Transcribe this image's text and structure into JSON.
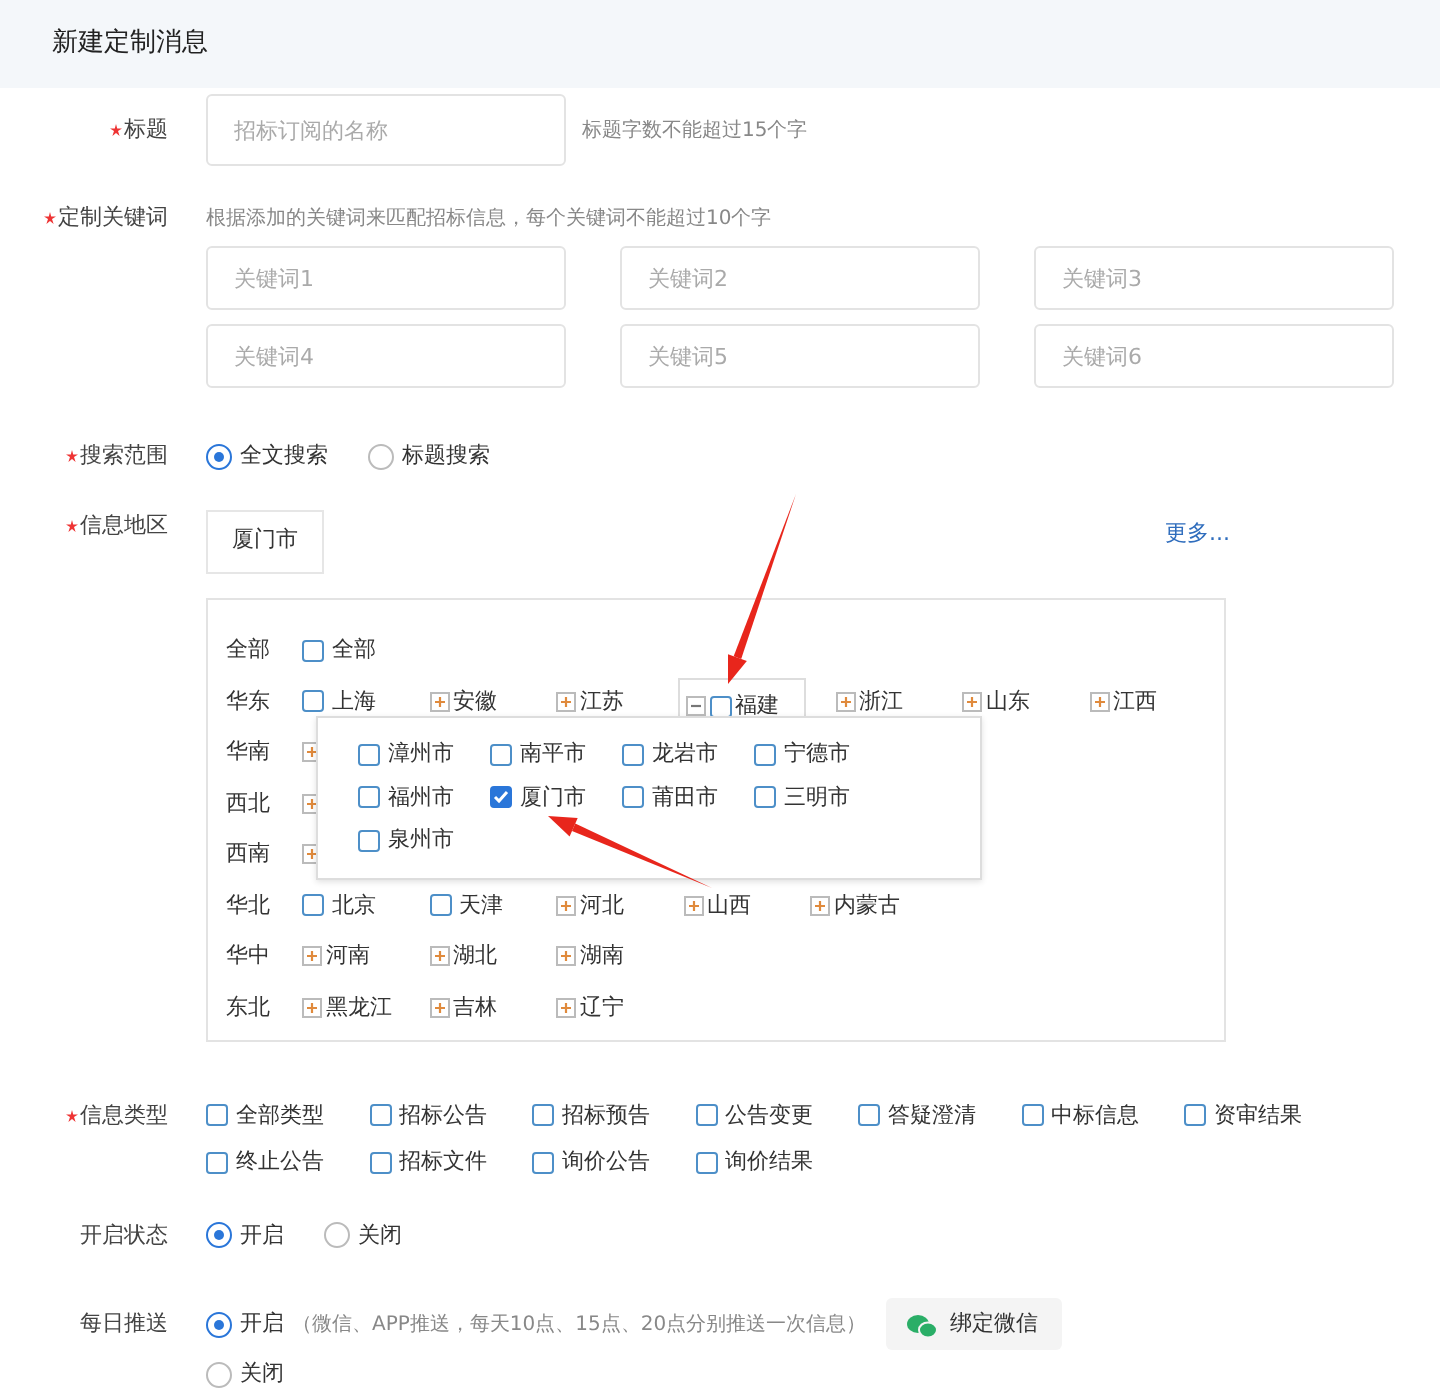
{
  "header": {
    "title": "新建定制消息"
  },
  "title_field": {
    "label": "标题",
    "required": true,
    "placeholder": "招标订阅的名称",
    "hint": "标题字数不能超过15个字"
  },
  "keywords": {
    "label": "定制关键词",
    "required": true,
    "hint": "根据添加的关键词来匹配招标信息，每个关键词不能超过10个字",
    "fields": [
      {
        "placeholder": "关键词1"
      },
      {
        "placeholder": "关键词2"
      },
      {
        "placeholder": "关键词3"
      },
      {
        "placeholder": "关键词4"
      },
      {
        "placeholder": "关键词5"
      },
      {
        "placeholder": "关键词6"
      }
    ]
  },
  "search_scope": {
    "label": "搜索范围",
    "required": true,
    "options": [
      {
        "label": "全文搜索",
        "selected": true
      },
      {
        "label": "标题搜索",
        "selected": false
      }
    ]
  },
  "region": {
    "label": "信息地区",
    "required": true,
    "tags": [
      "厦门市"
    ],
    "more_link": "更多...",
    "rows": [
      {
        "label": "全部",
        "items": [
          {
            "kind": "leaf",
            "label": "全部",
            "checked": false
          }
        ]
      },
      {
        "label": "华东",
        "items": [
          {
            "kind": "leaf",
            "label": "上海",
            "checked": false
          },
          {
            "kind": "group",
            "label": "安徽",
            "expanded": false
          },
          {
            "kind": "group",
            "label": "江苏",
            "expanded": false
          },
          {
            "kind": "group",
            "label": "福建",
            "expanded": true,
            "checked": false
          },
          {
            "kind": "group",
            "label": "浙江",
            "expanded": false
          },
          {
            "kind": "group",
            "label": "山东",
            "expanded": false
          },
          {
            "kind": "group",
            "label": "江西",
            "expanded": false
          }
        ]
      },
      {
        "label": "华南",
        "items": [
          {
            "kind": "group",
            "expanded": false
          }
        ]
      },
      {
        "label": "西北",
        "items": [
          {
            "kind": "group",
            "expanded": false
          }
        ]
      },
      {
        "label": "西南",
        "items": [
          {
            "kind": "group",
            "expanded": false
          }
        ]
      },
      {
        "label": "华北",
        "items": [
          {
            "kind": "leaf",
            "label": "北京",
            "checked": false
          },
          {
            "kind": "leaf",
            "label": "天津",
            "checked": false
          },
          {
            "kind": "group",
            "label": "河北",
            "expanded": false
          },
          {
            "kind": "group",
            "label": "山西",
            "expanded": false
          },
          {
            "kind": "group",
            "label": "内蒙古",
            "expanded": false
          }
        ]
      },
      {
        "label": "华中",
        "items": [
          {
            "kind": "group",
            "label": "河南",
            "expanded": false
          },
          {
            "kind": "group",
            "label": "湖北",
            "expanded": false
          },
          {
            "kind": "group",
            "label": "湖南",
            "expanded": false
          }
        ]
      },
      {
        "label": "东北",
        "items": [
          {
            "kind": "group",
            "label": "黑龙江",
            "expanded": false
          },
          {
            "kind": "group",
            "label": "吉林",
            "expanded": false
          },
          {
            "kind": "group",
            "label": "辽宁",
            "expanded": false
          }
        ]
      }
    ],
    "popup": {
      "items": [
        {
          "label": "漳州市",
          "checked": false
        },
        {
          "label": "南平市",
          "checked": false
        },
        {
          "label": "龙岩市",
          "checked": false
        },
        {
          "label": "宁德市",
          "checked": false
        },
        {
          "label": "福州市",
          "checked": false
        },
        {
          "label": "厦门市",
          "checked": true
        },
        {
          "label": "莆田市",
          "checked": false
        },
        {
          "label": "三明市",
          "checked": false
        },
        {
          "label": "泉州市",
          "checked": false
        }
      ]
    },
    "annotations": [
      {
        "kind": "arrow"
      },
      {
        "kind": "arrow"
      }
    ]
  },
  "info_type": {
    "label": "信息类型",
    "required": true,
    "options": [
      {
        "label": "全部类型",
        "checked": false
      },
      {
        "label": "招标公告",
        "checked": false
      },
      {
        "label": "招标预告",
        "checked": false
      },
      {
        "label": "公告变更",
        "checked": false
      },
      {
        "label": "答疑澄清",
        "checked": false
      },
      {
        "label": "中标信息",
        "checked": false
      },
      {
        "label": "资审结果",
        "checked": false
      },
      {
        "label": "终止公告",
        "checked": false
      },
      {
        "label": "招标文件",
        "checked": false
      },
      {
        "label": "询价公告",
        "checked": false
      },
      {
        "label": "询价结果",
        "checked": false
      }
    ]
  },
  "status": {
    "label": "开启状态",
    "required": false,
    "options": [
      {
        "label": "开启",
        "selected": true
      },
      {
        "label": "关闭",
        "selected": false
      }
    ]
  },
  "daily_push": {
    "label": "每日推送",
    "required": false,
    "options": [
      {
        "label": "开启",
        "selected": true,
        "note": "（微信、APP推送，每天10点、15点、20点分别推送一次信息）",
        "button": "绑定微信"
      },
      {
        "label": "关闭",
        "selected": false
      }
    ]
  }
}
